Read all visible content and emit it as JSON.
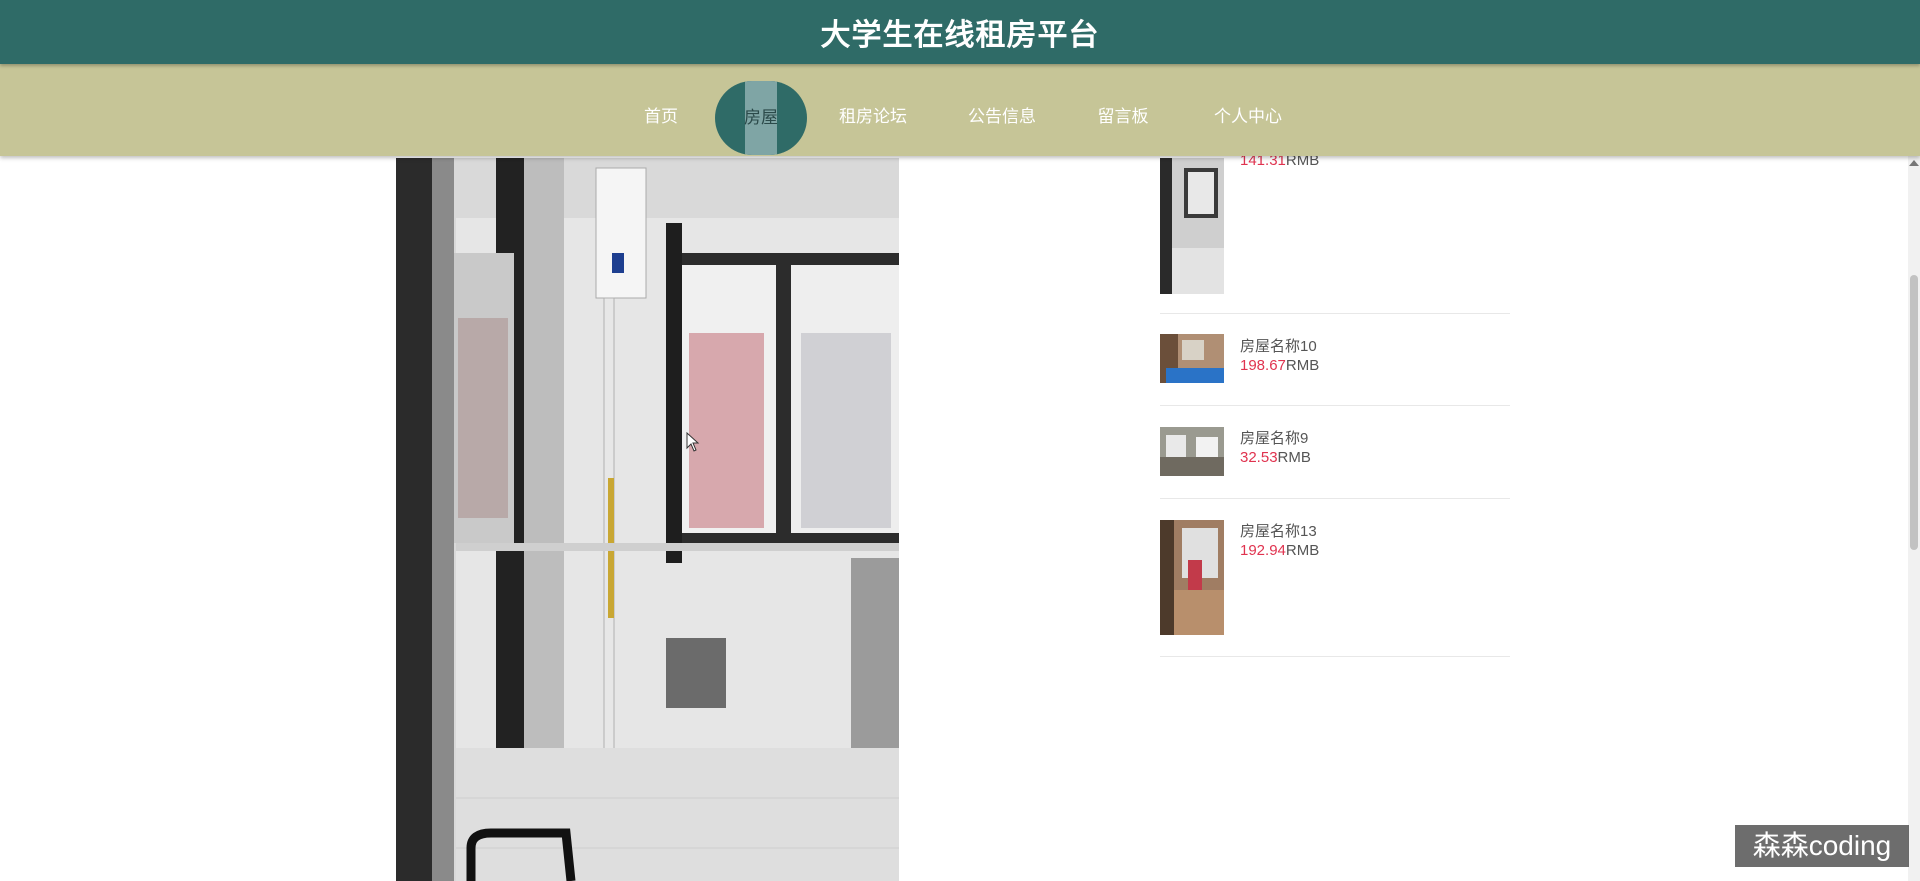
{
  "header": {
    "title": "大学生在线租房平台"
  },
  "nav": {
    "items": [
      {
        "label": "首页"
      },
      {
        "label": "房屋"
      },
      {
        "label": "租房论坛"
      },
      {
        "label": "公告信息"
      },
      {
        "label": "留言板"
      },
      {
        "label": "个人中心"
      }
    ],
    "active_index": 1
  },
  "listing": [
    {
      "name": "",
      "price": "141.31",
      "unit": "RMB"
    },
    {
      "name": "房屋名称10",
      "price": "198.67",
      "unit": "RMB"
    },
    {
      "name": "房屋名称9",
      "price": "32.53",
      "unit": "RMB"
    },
    {
      "name": "房屋名称13",
      "price": "192.94",
      "unit": "RMB"
    }
  ],
  "watermark": "森森coding",
  "colors": {
    "header_bg": "#2f6b67",
    "nav_bg": "#c6c597",
    "price": "#e0334f"
  }
}
